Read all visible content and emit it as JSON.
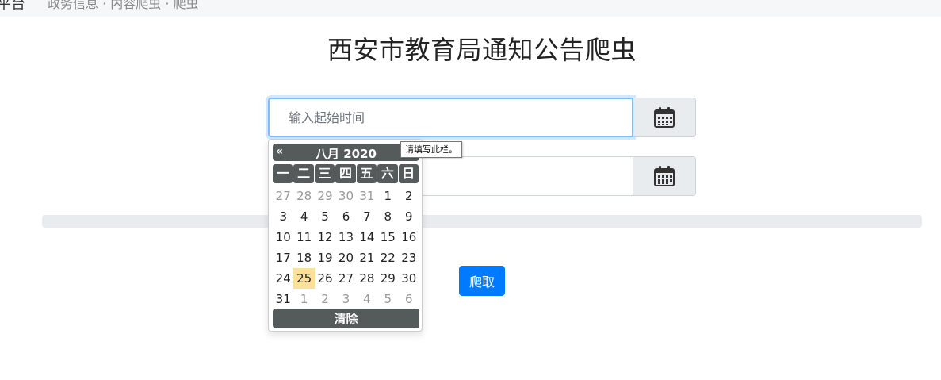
{
  "topbar": {
    "nav_text": "平台",
    "nav_sub": "政务信息 · 内容爬虫 · 爬虫"
  },
  "page": {
    "title": "西安市教育局通知公告爬虫"
  },
  "start_date": {
    "placeholder": "输入起始时间",
    "value": ""
  },
  "end_date": {
    "placeholder": "",
    "value": ""
  },
  "tooltip": {
    "text": "请填写此栏。"
  },
  "datepicker": {
    "prev": "«",
    "month_label": "八月 2020",
    "weekdays": [
      "一",
      "二",
      "三",
      "四",
      "五",
      "六",
      "日"
    ],
    "rows": [
      [
        "27",
        "28",
        "29",
        "30",
        "31",
        "1",
        "2"
      ],
      [
        "3",
        "4",
        "5",
        "6",
        "7",
        "8",
        "9"
      ],
      [
        "10",
        "11",
        "12",
        "13",
        "14",
        "15",
        "16"
      ],
      [
        "17",
        "18",
        "19",
        "20",
        "21",
        "22",
        "23"
      ],
      [
        "24",
        "25",
        "26",
        "27",
        "28",
        "29",
        "30"
      ],
      [
        "31",
        "1",
        "2",
        "3",
        "4",
        "5",
        "6"
      ]
    ],
    "muted_cells": [
      "0-0",
      "0-1",
      "0-2",
      "0-3",
      "0-4",
      "5-1",
      "5-2",
      "5-3",
      "5-4",
      "5-5",
      "5-6"
    ],
    "today_cell": "4-1",
    "clear_label": "清除"
  },
  "progress": {
    "value_percent": 0
  },
  "actions": {
    "crawl_label": "爬取"
  },
  "colors": {
    "primary": "#007bff",
    "picker_header": "#555a5b",
    "today": "#fde19a"
  }
}
